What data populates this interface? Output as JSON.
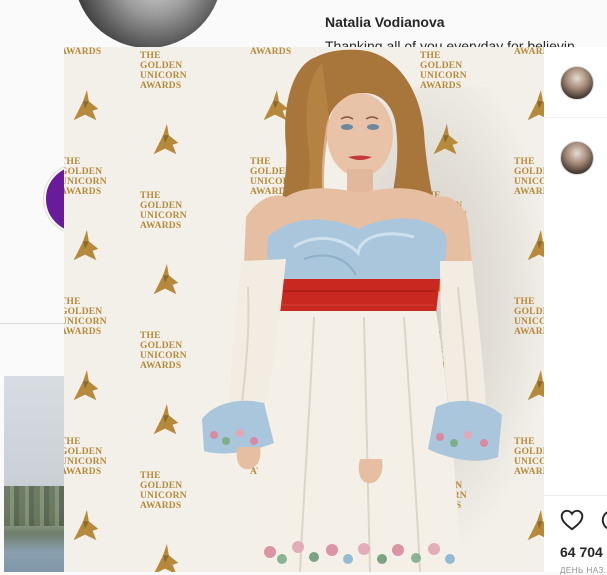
{
  "profile": {
    "username": "Natalia Vodianova",
    "bio_excerpt": "Thanking all of you everyday for believin"
  },
  "post": {
    "likes_text": "64 704",
    "date_text": "ДЕНЬ НАЗ..."
  },
  "backdrop": {
    "logo_lines": [
      "THE",
      "GOLDEN",
      "UNICORN",
      "AWARDS"
    ]
  },
  "colors": {
    "gold": "#b68a3a",
    "dress_blue": "#a9c6dc",
    "sash_red": "#c8281f",
    "skirt_ivory": "#f4f0e7"
  },
  "icons": [
    "heart-icon",
    "comment-icon",
    "unicorn-logo-icon"
  ]
}
